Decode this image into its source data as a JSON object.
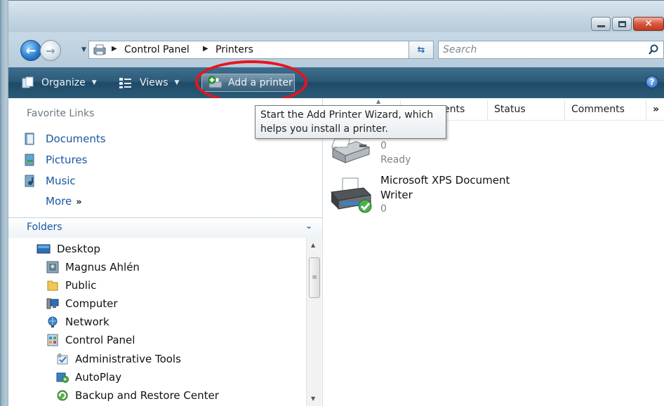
{
  "window": {
    "caption_buttons": [
      "minimize",
      "maximize",
      "close"
    ]
  },
  "address_bar": {
    "breadcrumbs": [
      "Control Panel",
      "Printers"
    ],
    "search_placeholder": "Search"
  },
  "command_bar": {
    "organize_label": "Organize",
    "views_label": "Views",
    "add_printer_label": "Add a printer",
    "help_label": "?"
  },
  "tooltip": {
    "line1": "Start the Add Printer Wizard, which",
    "line2": "helps you install a printer."
  },
  "nav_pane": {
    "favorite_links_title": "Favorite Links",
    "favorites": [
      {
        "label": "Documents",
        "icon": "documents-icon"
      },
      {
        "label": "Pictures",
        "icon": "pictures-icon"
      },
      {
        "label": "Music",
        "icon": "music-icon"
      }
    ],
    "more_label": "More",
    "more_glyph": "»",
    "folders_label": "Folders",
    "tree": [
      {
        "label": "Desktop",
        "icon": "desktop-icon"
      },
      {
        "label": "Magnus Ahlén",
        "icon": "user-folder-icon"
      },
      {
        "label": "Public",
        "icon": "folder-icon"
      },
      {
        "label": "Computer",
        "icon": "computer-icon"
      },
      {
        "label": "Network",
        "icon": "network-icon"
      },
      {
        "label": "Control Panel",
        "icon": "control-panel-icon"
      },
      {
        "label": "Administrative Tools",
        "icon": "admin-tools-icon"
      },
      {
        "label": "AutoPlay",
        "icon": "autoplay-icon"
      },
      {
        "label": "Backup and Restore Center",
        "icon": "backup-icon"
      }
    ]
  },
  "content": {
    "columns": [
      "ents",
      "Status",
      "Comments",
      "»"
    ],
    "printers": [
      {
        "name": "",
        "documents": "0",
        "status": "Ready",
        "icon": "fax-icon"
      },
      {
        "name_line1": "Microsoft XPS Document",
        "name_line2": "Writer",
        "documents": "0",
        "icon": "printer-default-icon"
      }
    ]
  },
  "colors": {
    "command_bar": "#2c5a78",
    "link_blue": "#1a55a3",
    "highlight_oval": "#e8141d"
  }
}
